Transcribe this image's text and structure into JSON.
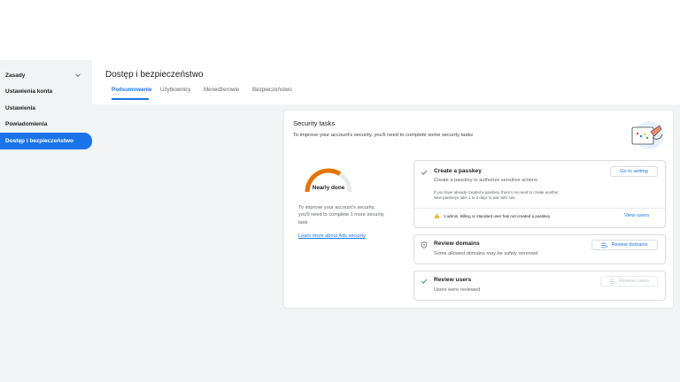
{
  "sidebar": {
    "items": [
      {
        "label": "Zasady"
      },
      {
        "label": "Ustawienia konta"
      },
      {
        "label": "Ustawienia"
      },
      {
        "label": "Powiadomienia"
      },
      {
        "label": "Dostęp i bezpieczeństwo"
      }
    ]
  },
  "header": {
    "title": "Dostęp i bezpieczeństwo",
    "tabs": [
      {
        "label": "Podsumowanie"
      },
      {
        "label": "Użytkownicy"
      },
      {
        "label": "Menedżerowie"
      },
      {
        "label": "Bezpieczeństwo"
      }
    ]
  },
  "security": {
    "title": "Security tasks",
    "subtitle": "To improve your account's security, you'll need to complete some security tasks",
    "gauge_label": "Nearly done",
    "description": "To improve your account's security, you'll need to complete 1 more security task",
    "learn_more": "Learn more about Ads security",
    "tasks": {
      "passkey": {
        "title": "Create a passkey",
        "desc": "Create a passkey to authorize sensitive actions",
        "note1": "If you have already created a passkey, there's no need to create another.",
        "note2": "New passkeys take 1 to 2 days to pair with Ads.",
        "warning": "1 admin, billing or standard user has not created a passkey",
        "button": "Go to setting",
        "link": "View users"
      },
      "domains": {
        "title": "Review domains",
        "desc": "Some allowed domains may be safely removed",
        "button": "Review domains"
      },
      "users": {
        "title": "Review users",
        "desc": "Users were reviewed",
        "button": "Review users"
      }
    }
  },
  "colors": {
    "accent": "#1a73e8",
    "gauge_progress": "#e37400",
    "gauge_track": "#e8eaed",
    "warning": "#f29900",
    "check": "#1e8e3e"
  }
}
